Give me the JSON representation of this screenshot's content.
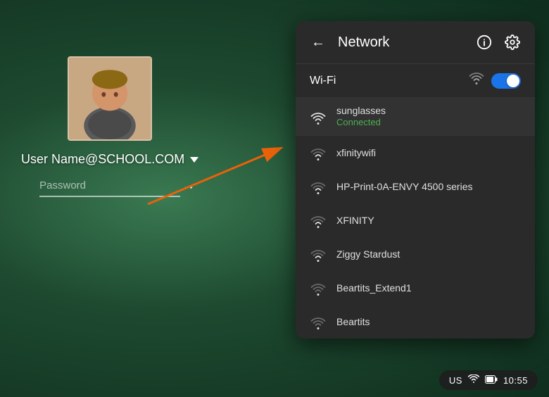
{
  "background": {
    "color": "#2d5a3d"
  },
  "login": {
    "username": "User Name@SCHOOL.COM",
    "password_placeholder": "Password",
    "chevron_label": "dropdown"
  },
  "network_panel": {
    "title": "Network",
    "back_label": "←",
    "info_icon": "info-icon",
    "settings_icon": "gear-icon",
    "wifi_section": {
      "label": "Wi-Fi",
      "toggle_state": "on"
    },
    "networks": [
      {
        "name": "sunglasses",
        "status": "Connected",
        "signal": "full",
        "connected": true
      },
      {
        "name": "xfinitywifi",
        "status": "",
        "signal": "medium",
        "connected": false
      },
      {
        "name": "HP-Print-0A-ENVY 4500 series",
        "status": "",
        "signal": "medium",
        "connected": false
      },
      {
        "name": "XFINITY",
        "status": "",
        "signal": "medium",
        "connected": false
      },
      {
        "name": "Ziggy Stardust",
        "status": "",
        "signal": "medium",
        "connected": false
      },
      {
        "name": "Beartits_Extend1",
        "status": "",
        "signal": "low",
        "connected": false
      },
      {
        "name": "Beartits",
        "status": "",
        "signal": "low",
        "connected": false
      }
    ]
  },
  "taskbar": {
    "region": "US",
    "time": "10:55"
  },
  "annotation": {
    "arrow_visible": true
  }
}
